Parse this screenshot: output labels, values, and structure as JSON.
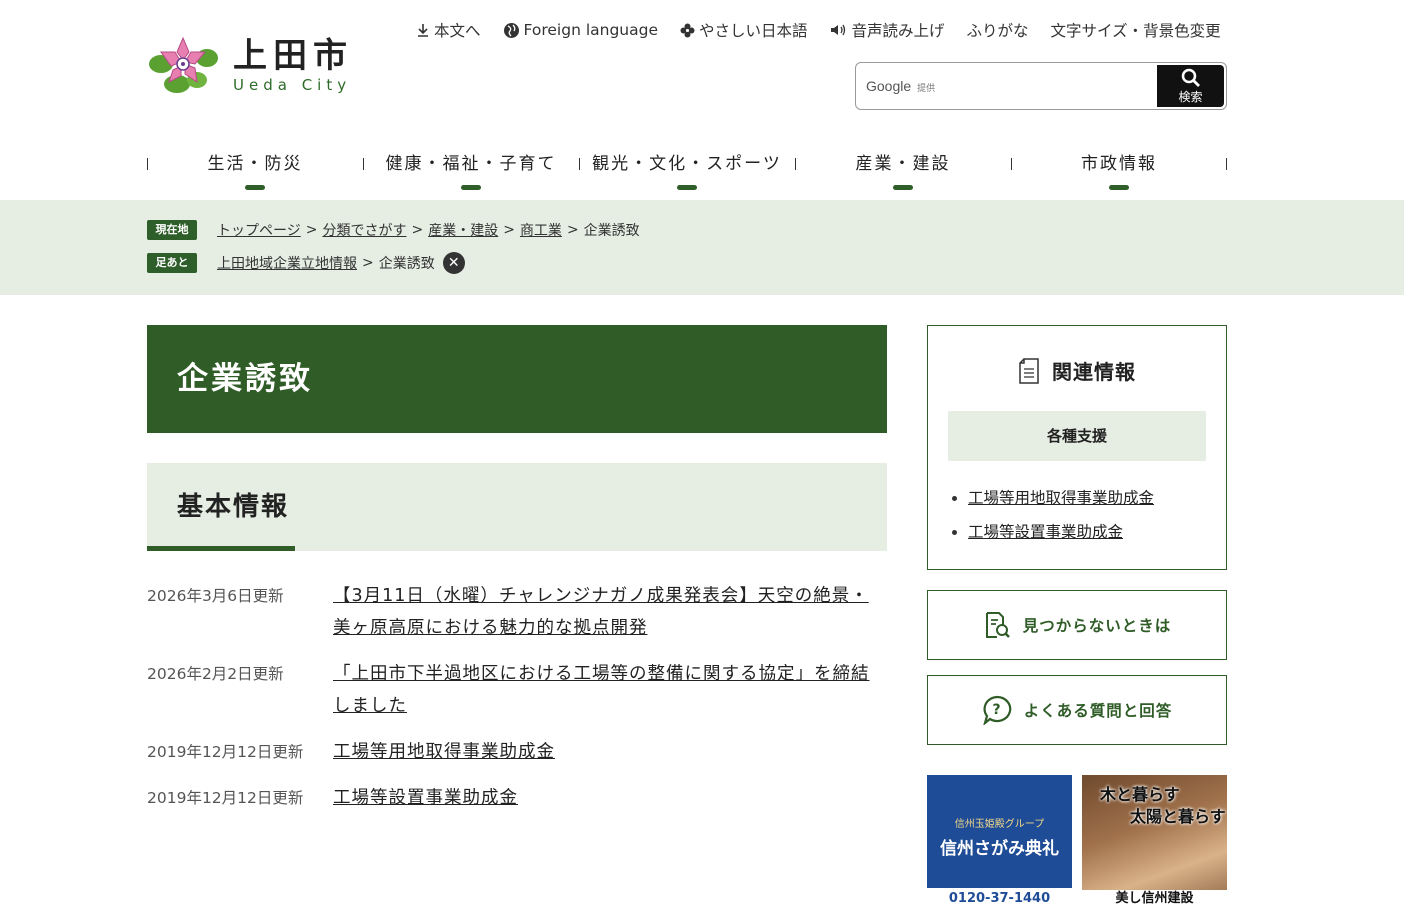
{
  "header": {
    "logo_ja": "上田市",
    "logo_en": "Ueda City",
    "util_links": [
      {
        "label": "本文へ",
        "icon": "download-arrow-icon"
      },
      {
        "label": "Foreign language",
        "icon": "globe-icon"
      },
      {
        "label": "やさしい日本語",
        "icon": "clover-icon"
      },
      {
        "label": "音声読み上げ",
        "icon": "speaker-icon"
      },
      {
        "label": "ふりがな",
        "icon": ""
      },
      {
        "label": "文字サイズ・背景色変更",
        "icon": ""
      }
    ],
    "search": {
      "google_label": "Google",
      "provided_label": "提供",
      "button_label": "検索"
    }
  },
  "gnav": [
    "生活・防災",
    "健康・福祉・子育て",
    "観光・文化・スポーツ",
    "産業・建設",
    "市政情報"
  ],
  "breadcrumb": {
    "current_tag": "現在地",
    "current": [
      "トップページ",
      "分類でさがす",
      "産業・建設",
      "商工業",
      "企業誘致"
    ],
    "history_tag": "足あと",
    "history": [
      "上田地域企業立地情報",
      "企業誘致"
    ]
  },
  "page_title": "企業誘致",
  "section_title": "基本情報",
  "news": [
    {
      "date": "2026年3月6日更新",
      "title": "【3月11日（水曜）チャレンジナガノ成果発表会】天空の絶景・美ヶ原高原における魅力的な拠点開発"
    },
    {
      "date": "2026年2月2日更新",
      "title": "「上田市下半過地区における工場等の整備に関する協定」を締結しました"
    },
    {
      "date": "2019年12月12日更新",
      "title": "工場等用地取得事業助成金"
    },
    {
      "date": "2019年12月12日更新",
      "title": "工場等設置事業助成金"
    }
  ],
  "sidebar": {
    "related_title": "関連情報",
    "related_sub": "各種支援",
    "related_links": [
      "工場等用地取得事業助成金",
      "工場等設置事業助成金"
    ],
    "not_found": "見つからないときは",
    "faq": "よくある質問と回答"
  },
  "banners": {
    "b1_small": "信州玉姫殿グループ",
    "b1_big": "信州さがみ典礼",
    "b1_phone": "0120-37-1440",
    "b2_line1": "木と暮らす",
    "b2_line2": "太陽と暮らす",
    "b2_bottom": "美し信州建設"
  },
  "colors": {
    "brand_green": "#2f5c27",
    "band_bg": "#e6eee4"
  }
}
